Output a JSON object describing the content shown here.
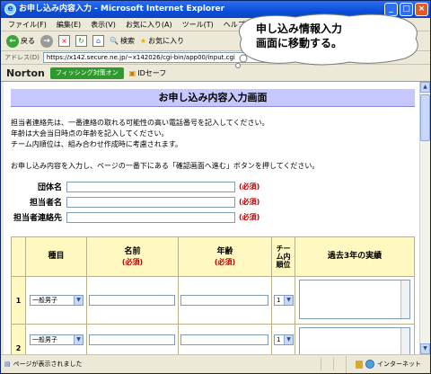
{
  "window": {
    "title": "お申し込み内容入力 - Microsoft Internet Explorer"
  },
  "menu": [
    "ファイル(F)",
    "編集(E)",
    "表示(V)",
    "お気に入り(A)",
    "ツール(T)",
    "ヘルプ(H)"
  ],
  "toolbar": {
    "back_label": "戻る",
    "search_label": "検索",
    "favorites_label": "お気に入り"
  },
  "address": {
    "label": "アドレス(D)",
    "url": "https://x142.secure.ne.jp/~x142026/cgi-bin/app00/input.cgi"
  },
  "norton": {
    "brand": "Norton",
    "phishing_label": "フィッシング対策オン",
    "idsafe_label": "IDセーフ"
  },
  "callout": {
    "line1": "申し込み情報入力",
    "line2": "画面に移動する。"
  },
  "page": {
    "title": "お申し込み内容入力画面",
    "intro": [
      "担当者連絡先は、一番連絡の取れる可能性の高い電話番号を記入してください。",
      "年齢は大会当日時点の年齢を記入してください。",
      "チーム内順位は、組み合わせ作成時に考慮されます。",
      "お申し込み内容を入力し、ページの一番下にある「確認画面へ進む」ボタンを押してください。"
    ],
    "fields": [
      {
        "label": "団体名",
        "required": "(必須)"
      },
      {
        "label": "担当者名",
        "required": "(必須)"
      },
      {
        "label": "担当者連絡先",
        "required": "(必須)"
      }
    ],
    "table": {
      "headers": {
        "type": "種目",
        "name": "名前",
        "name_req": "(必須)",
        "age": "年齢",
        "age_req": "(必須)",
        "rank_line1": "チー",
        "rank_line2": "ム内",
        "rank_line3": "順位",
        "record": "過去3年の実績"
      },
      "rows": [
        {
          "num": "1",
          "type": "一般男子",
          "rank": "1"
        },
        {
          "num": "2",
          "type": "一般男子",
          "rank": "1"
        }
      ]
    }
  },
  "status": {
    "text": "ページが表示されました",
    "zone": "インターネット"
  }
}
